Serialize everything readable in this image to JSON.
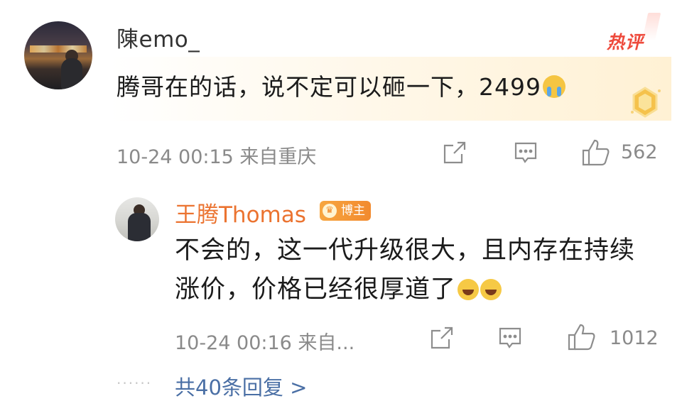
{
  "comment": {
    "username": "陳emo_",
    "hot_label": "热评",
    "text": "腾哥在的话，说不定可以砸一下，2499",
    "text_emoji": "crying-face",
    "time_location": "10-24 00:15 来自重庆",
    "like_count": "562"
  },
  "reply": {
    "username": "王腾Thomas",
    "badge_label": "博主",
    "text": "不会的，这一代升级很大，且内存在持续涨价，价格已经很厚道了",
    "text_emojis": [
      "laughing-face",
      "laughing-face"
    ],
    "time_location": "10-24 00:16 来自...",
    "like_count": "1012"
  },
  "thread": {
    "dots": "······",
    "view_replies_label": "共40条回复 >"
  },
  "colors": {
    "username_reply": "#eb7330",
    "hot_label": "#ee4a3c",
    "link": "#4a6fa5",
    "meta": "#8a8a8a"
  }
}
